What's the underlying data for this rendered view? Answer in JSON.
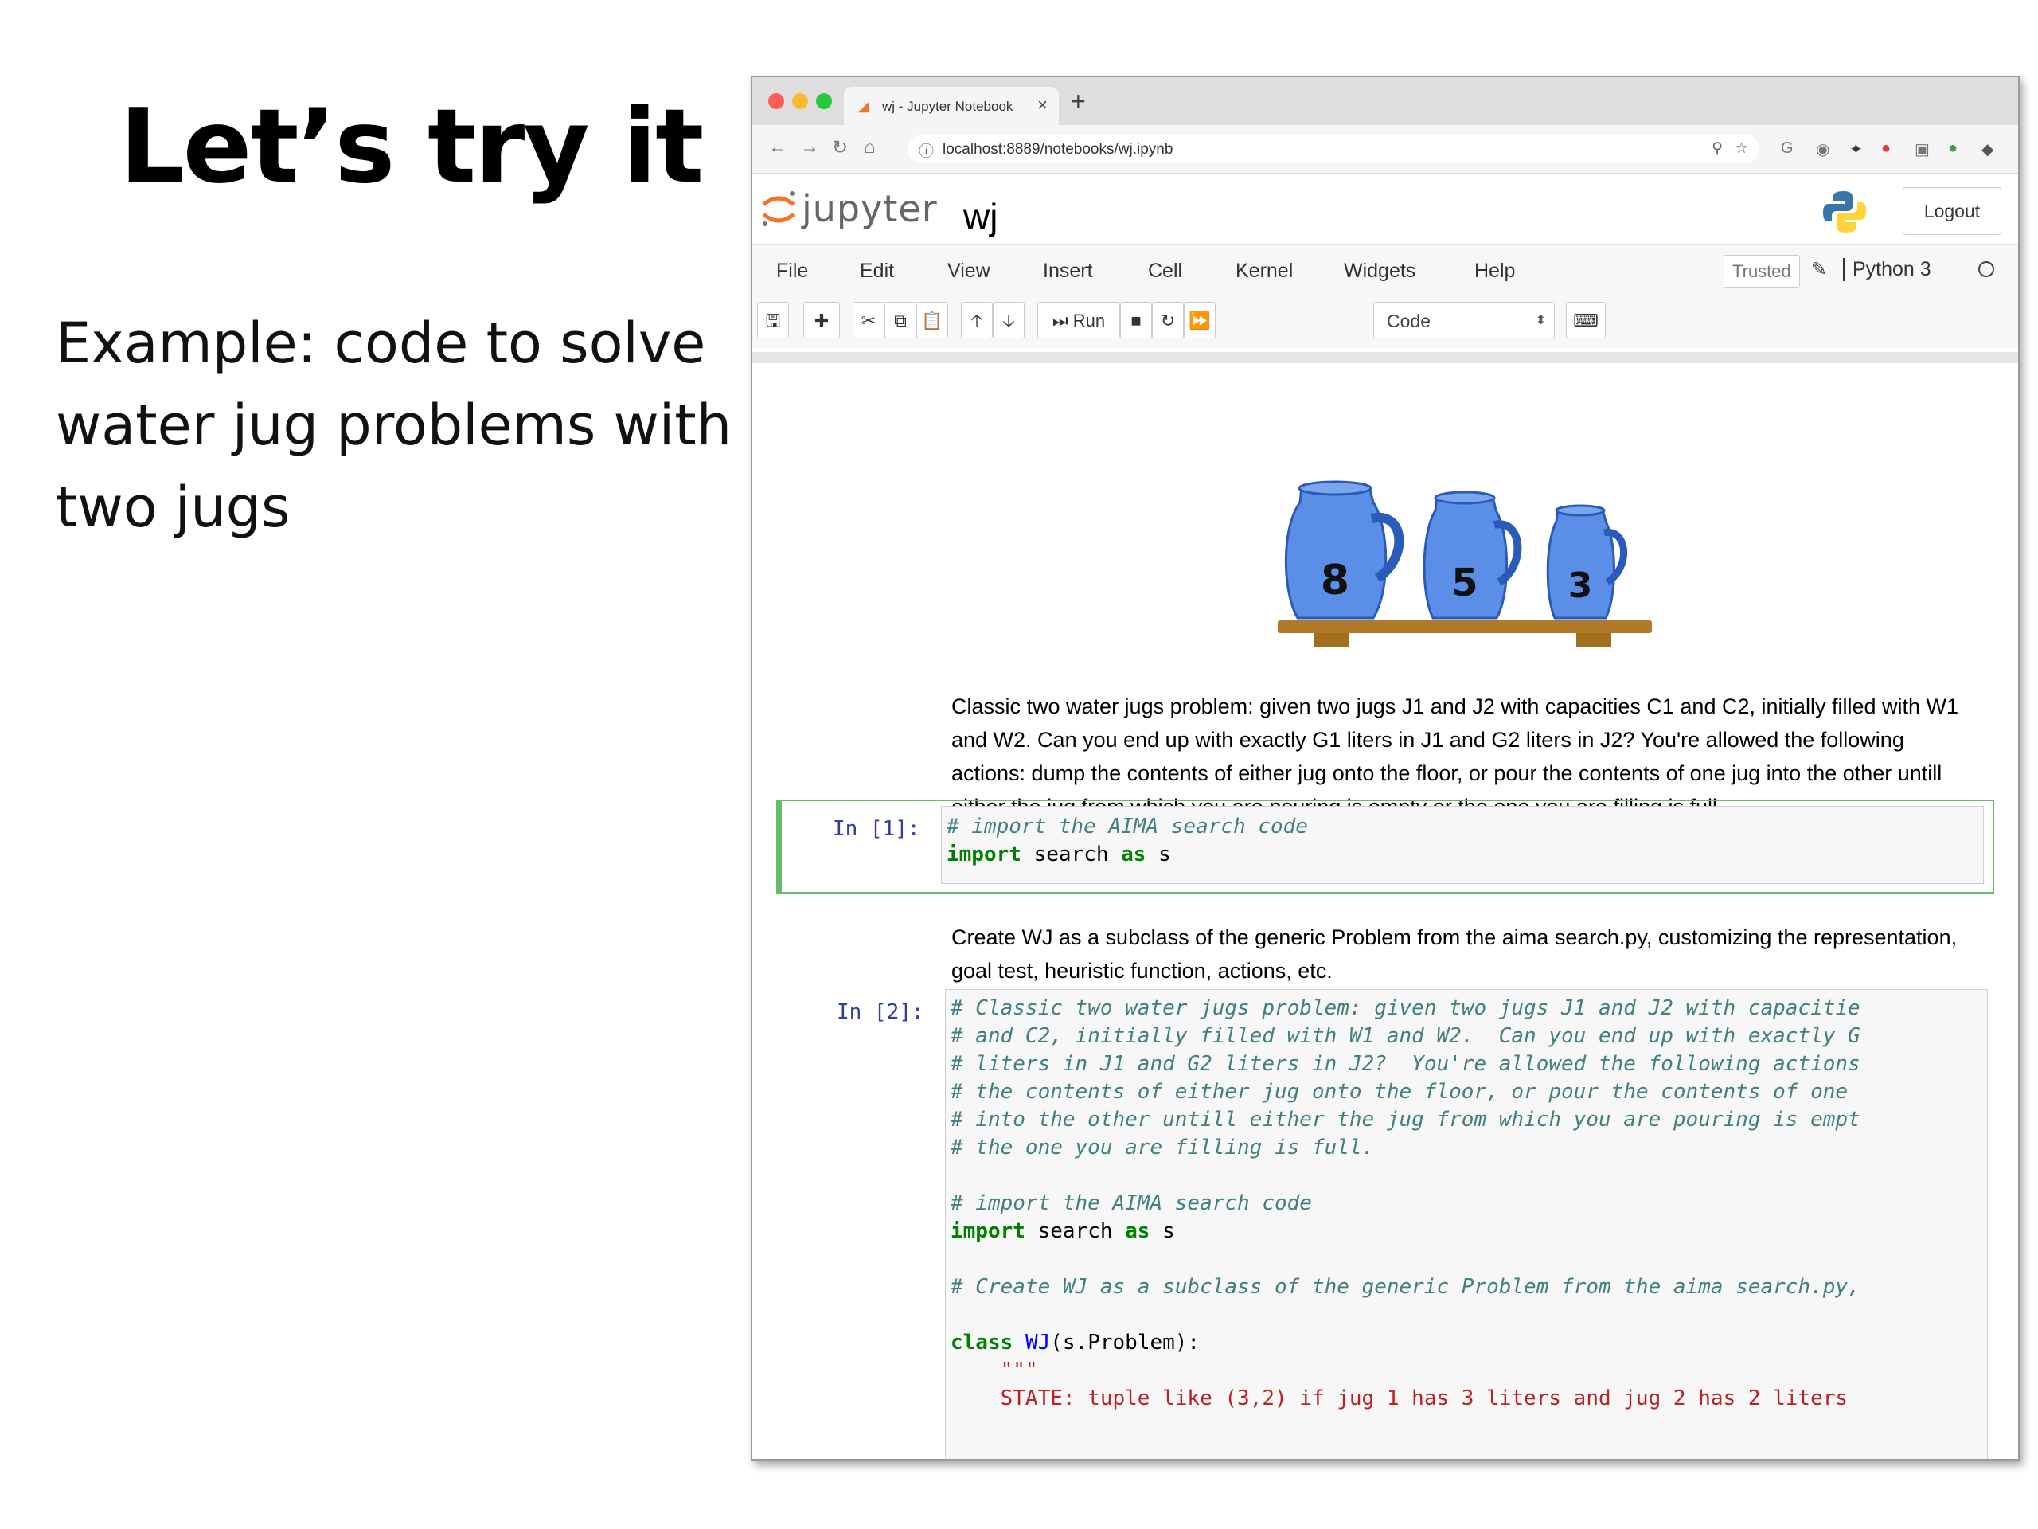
{
  "slide": {
    "title": "Let’s try it",
    "body": "Example: code to solve water jug problems with two jugs"
  },
  "browser": {
    "tab_title": "wj - Jupyter Notebook",
    "tab_close": "×",
    "new_tab": "+",
    "url": "localhost:8889/notebooks/wj.ipynb"
  },
  "jupyter": {
    "brand": "jupyter",
    "notebook_name": "wj",
    "logout_label": "Logout",
    "menu": [
      "File",
      "Edit",
      "View",
      "Insert",
      "Cell",
      "Kernel",
      "Widgets",
      "Help"
    ],
    "trusted_label": "Trusted",
    "kernel_name": "Python 3",
    "run_label": "Run",
    "cell_type": "Code"
  },
  "jug_labels": [
    "8",
    "5",
    "3"
  ],
  "markdown": {
    "problem": "Classic two water jugs problem: given two jugs J1 and J2 with capacities C1 and C2, initially filled with W1 and W2. Can you end up with exactly G1 liters in J1 and G2 liters in J2? You're allowed the following actions: dump the contents of either jug onto the floor, or pour the contents of one jug into the other untill either the jug from which you are pouring is empty or the one you are filling is full.",
    "create": "Create WJ as a subclass of the generic Problem from the aima search.py, customizing the representation, goal test, heuristic function, actions, etc."
  },
  "cell1": {
    "prompt": "In [1]:",
    "comment": "# import the AIMA search code",
    "kw_import": "import",
    "rest1": " search ",
    "kw_as": "as",
    "rest2": " s"
  },
  "cell2": {
    "prompt": "In [2]:",
    "comments": [
      "# Classic two water jugs problem: given two jugs J1 and J2 with capacitie",
      "# and C2, initially filled with W1 and W2.  Can you end up with exactly G",
      "# liters in J1 and G2 liters in J2?  You're allowed the following actions",
      "# the contents of either jug onto the floor, or pour the contents of one ",
      "# into the other untill either the jug from which you are pouring is empt",
      "# the one you are filling is full."
    ],
    "comment_import": "# import the AIMA search code",
    "kw_import": "import",
    "rest1": " search ",
    "kw_as": "as",
    "rest2": " s",
    "comment_create": "# Create WJ as a subclass of the generic Problem from the aima search.py,",
    "kw_class": "class",
    "class_name": "WJ",
    "class_rest": "(s.Problem):",
    "docstring_open": "    \"\"\"",
    "state_line": "    STATE: tuple like (3,2) if jug 1 has 3 liters and jug 2 has 2 liters"
  }
}
